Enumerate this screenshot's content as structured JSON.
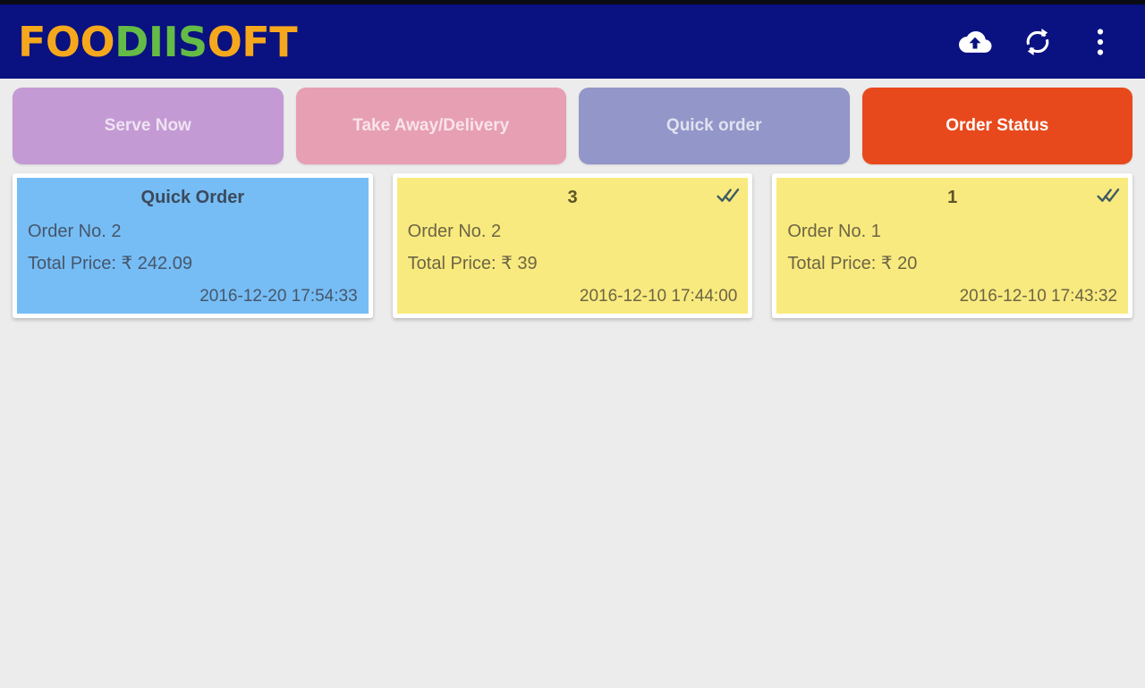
{
  "appbar": {
    "brand": {
      "part_1": "FOO",
      "part_2": "DIIS",
      "part_3": "OFT",
      "full_text": "FOODIISOFT",
      "color_orange": "#f6a81c",
      "color_green": "#64bb46"
    },
    "background_color": "#0a1180",
    "actions": [
      {
        "name": "cloud-upload-icon",
        "label": "Cloud Upload"
      },
      {
        "name": "sync-icon",
        "label": "Sync"
      },
      {
        "name": "overflow-menu-icon",
        "label": "More options"
      }
    ]
  },
  "tabs": [
    {
      "label": "Serve Now",
      "color": "#c49ad4",
      "active": false
    },
    {
      "label": "Take Away/Delivery",
      "color": "#e79fb4",
      "active": false
    },
    {
      "label": "Quick order",
      "color": "#9396c8",
      "active": false
    },
    {
      "label": "Order Status",
      "color": "#e8491c",
      "active": true
    }
  ],
  "orders": [
    {
      "title": "Quick Order",
      "order_no": "Order No. 2",
      "total_price": "Total Price: ₹ 242.09",
      "timestamp": "2016-12-20 17:54:33",
      "theme": "blue",
      "checked": false
    },
    {
      "title": "3",
      "order_no": "Order No. 2",
      "total_price": "Total Price: ₹ 39",
      "timestamp": "2016-12-10 17:44:00",
      "theme": "yellow",
      "checked": true
    },
    {
      "title": "1",
      "order_no": "Order No. 1",
      "total_price": "Total Price: ₹ 20",
      "timestamp": "2016-12-10 17:43:32",
      "theme": "yellow",
      "checked": true
    }
  ],
  "page": {
    "background_color": "#ececec",
    "check_icon_color": "#3f5b63"
  }
}
